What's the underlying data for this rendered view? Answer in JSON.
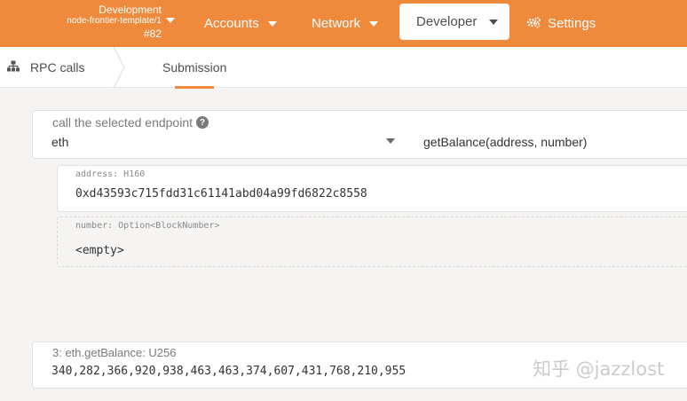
{
  "topbar": {
    "chain_name": "Development",
    "node_name": "node-frontier-template/1",
    "block": "#82",
    "nav": {
      "accounts": "Accounts",
      "network": "Network",
      "developer": "Developer",
      "settings": "Settings"
    },
    "accent_color": "#ef8a3c"
  },
  "subbar": {
    "rpc_tab": "RPC calls",
    "submission_tab": "Submission"
  },
  "endpoint": {
    "label": "call the selected endpoint",
    "section": "eth",
    "method": "getBalance(address, number)"
  },
  "params": [
    {
      "label": "address: H160",
      "value": "0xd43593c715fdd31c61141abd04a99fd6822c8558"
    },
    {
      "label": "number: Option<BlockNumber>",
      "value": "<empty>"
    }
  ],
  "result": {
    "label": "3: eth.getBalance: U256",
    "value": "340,282,366,920,938,463,463,374,607,431,768,210,955"
  },
  "watermark": "知乎 @jazzlost",
  "icons": {
    "chain_selector": "chevron-down-icon",
    "settings": "gear-icon",
    "rpc": "sitemap-icon",
    "help": "question-circle-icon"
  }
}
